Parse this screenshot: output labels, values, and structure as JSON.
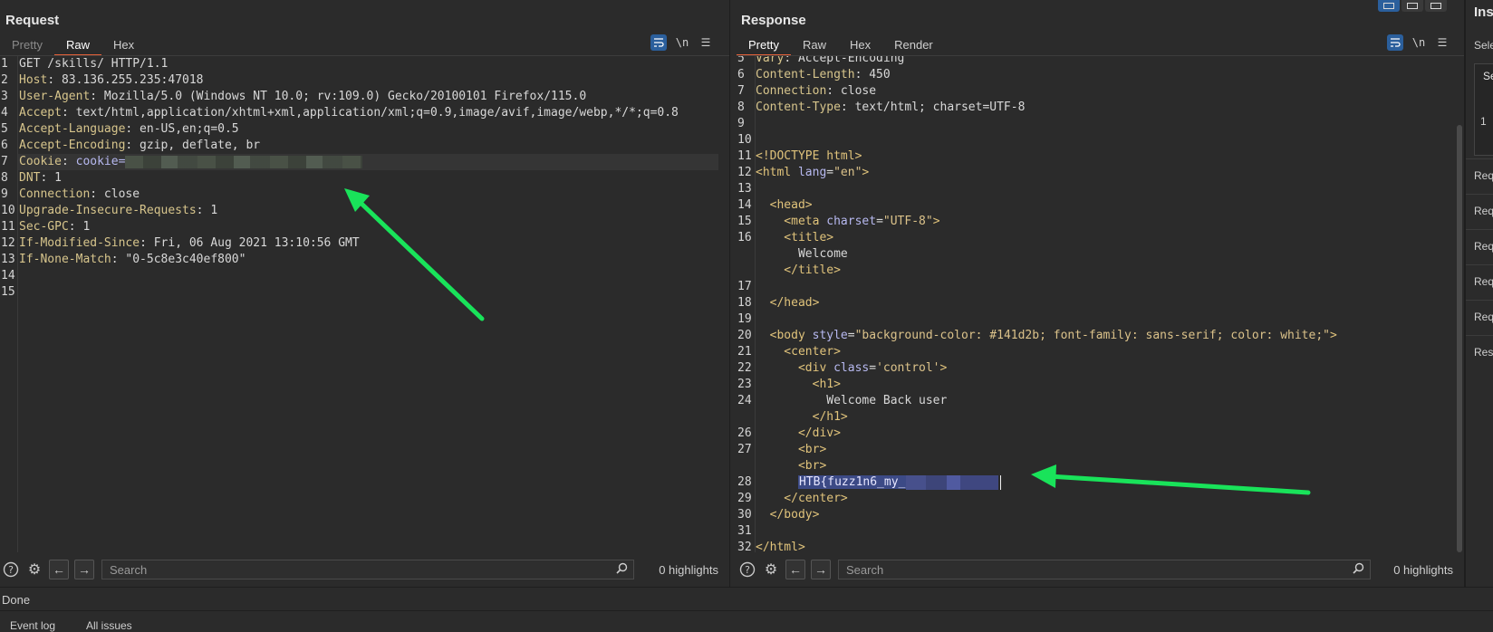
{
  "request": {
    "title": "Request",
    "tabs": [
      "Pretty",
      "Raw",
      "Hex"
    ],
    "active_tab": "Raw",
    "tools": {
      "wrap_icon": "wrap-icon",
      "newline_label": "\\n",
      "menu_icon": "menu-icon"
    },
    "lines": [
      {
        "n": "1",
        "parts": [
          {
            "t": "GET /skills/ HTTP/1.1",
            "c": "txt"
          }
        ]
      },
      {
        "n": "2",
        "parts": [
          {
            "t": "Host",
            "c": "hk"
          },
          {
            "t": ": 83.136.255.235:47018",
            "c": "txt"
          }
        ]
      },
      {
        "n": "3",
        "parts": [
          {
            "t": "User-Agent",
            "c": "hk"
          },
          {
            "t": ": Mozilla/5.0 (Windows NT 10.0; rv:109.0) Gecko/20100101 Firefox/115.0",
            "c": "txt"
          }
        ]
      },
      {
        "n": "4",
        "parts": [
          {
            "t": "Accept",
            "c": "hk"
          },
          {
            "t": ": text/html,application/xhtml+xml,application/xml;q=0.9,image/avif,image/webp,*/*;q=0.8",
            "c": "txt"
          }
        ]
      },
      {
        "n": "5",
        "parts": [
          {
            "t": "Accept-Language",
            "c": "hk"
          },
          {
            "t": ": en-US,en;q=0.5",
            "c": "txt"
          }
        ]
      },
      {
        "n": "6",
        "parts": [
          {
            "t": "Accept-Encoding",
            "c": "hk"
          },
          {
            "t": ": gzip, deflate, br",
            "c": "txt"
          }
        ]
      },
      {
        "n": "7",
        "parts": [
          {
            "t": "Cookie",
            "c": "hk"
          },
          {
            "t": ": ",
            "c": "txt"
          },
          {
            "t": "cookie=",
            "c": "attr"
          }
        ],
        "blur": "cookie"
      },
      {
        "n": "8",
        "parts": [
          {
            "t": "DNT",
            "c": "hk"
          },
          {
            "t": ": 1",
            "c": "txt"
          }
        ]
      },
      {
        "n": "9",
        "parts": [
          {
            "t": "Connection",
            "c": "hk"
          },
          {
            "t": ": close",
            "c": "txt"
          }
        ]
      },
      {
        "n": "10",
        "parts": [
          {
            "t": "Upgrade-Insecure-Requests",
            "c": "hk"
          },
          {
            "t": ": 1",
            "c": "txt"
          }
        ]
      },
      {
        "n": "11",
        "parts": [
          {
            "t": "Sec-GPC",
            "c": "hk"
          },
          {
            "t": ": 1",
            "c": "txt"
          }
        ]
      },
      {
        "n": "12",
        "parts": [
          {
            "t": "If-Modified-Since",
            "c": "hk"
          },
          {
            "t": ": Fri, 06 Aug 2021 13:10:56 GMT",
            "c": "txt"
          }
        ]
      },
      {
        "n": "13",
        "parts": [
          {
            "t": "If-None-Match",
            "c": "hk"
          },
          {
            "t": ": \"0-5c8e3c40ef800\"",
            "c": "txt"
          }
        ]
      },
      {
        "n": "14",
        "parts": []
      },
      {
        "n": "15",
        "parts": []
      }
    ],
    "search": {
      "placeholder": "Search",
      "highlights": "0 highlights"
    }
  },
  "response": {
    "title": "Response",
    "tabs": [
      "Pretty",
      "Raw",
      "Hex",
      "Render"
    ],
    "active_tab": "Pretty",
    "tools": {
      "wrap_icon": "wrap-icon",
      "newline_label": "\\n",
      "menu_icon": "menu-icon"
    },
    "lines": [
      {
        "n": "5",
        "parts": [
          {
            "t": "Vary",
            "c": "hk"
          },
          {
            "t": ": Accept-Encoding",
            "c": "txt"
          }
        ],
        "partial": true
      },
      {
        "n": "6",
        "parts": [
          {
            "t": "Content-Length",
            "c": "hk"
          },
          {
            "t": ": 450",
            "c": "txt"
          }
        ]
      },
      {
        "n": "7",
        "parts": [
          {
            "t": "Connection",
            "c": "hk"
          },
          {
            "t": ": close",
            "c": "txt"
          }
        ]
      },
      {
        "n": "8",
        "parts": [
          {
            "t": "Content-Type",
            "c": "hk"
          },
          {
            "t": ": text/html; charset=UTF-8",
            "c": "txt"
          }
        ]
      },
      {
        "n": "9",
        "parts": []
      },
      {
        "n": "10",
        "parts": []
      },
      {
        "n": "11",
        "parts": [
          {
            "t": "<!DOCTYPE html>",
            "c": "tag"
          }
        ]
      },
      {
        "n": "12",
        "parts": [
          {
            "t": "<html ",
            "c": "tag"
          },
          {
            "t": "lang",
            "c": "attr"
          },
          {
            "t": "=",
            "c": "txt"
          },
          {
            "t": "\"en\"",
            "c": "str"
          },
          {
            "t": ">",
            "c": "tag"
          }
        ]
      },
      {
        "n": "13",
        "parts": []
      },
      {
        "n": "14",
        "parts": [
          {
            "t": "  <head>",
            "c": "tag"
          }
        ]
      },
      {
        "n": "15",
        "parts": [
          {
            "t": "    <meta ",
            "c": "tag"
          },
          {
            "t": "charset",
            "c": "attr"
          },
          {
            "t": "=",
            "c": "txt"
          },
          {
            "t": "\"UTF-8\"",
            "c": "str"
          },
          {
            "t": ">",
            "c": "tag"
          }
        ]
      },
      {
        "n": "16",
        "parts": [
          {
            "t": "    <title>",
            "c": "tag"
          }
        ]
      },
      {
        "n": "",
        "parts": [
          {
            "t": "      Welcome",
            "c": "txt"
          }
        ]
      },
      {
        "n": "",
        "parts": [
          {
            "t": "    </title>",
            "c": "tag"
          }
        ]
      },
      {
        "n": "17",
        "parts": []
      },
      {
        "n": "18",
        "parts": [
          {
            "t": "  </head>",
            "c": "tag"
          }
        ]
      },
      {
        "n": "19",
        "parts": []
      },
      {
        "n": "20",
        "parts": [
          {
            "t": "  <body ",
            "c": "tag"
          },
          {
            "t": "style",
            "c": "attr"
          },
          {
            "t": "=",
            "c": "txt"
          },
          {
            "t": "\"background-color: #141d2b; font-family: sans-serif; color: white;\"",
            "c": "str"
          },
          {
            "t": ">",
            "c": "tag"
          }
        ]
      },
      {
        "n": "21",
        "parts": [
          {
            "t": "    <center>",
            "c": "tag"
          }
        ]
      },
      {
        "n": "22",
        "parts": [
          {
            "t": "      <div ",
            "c": "tag"
          },
          {
            "t": "class",
            "c": "attr"
          },
          {
            "t": "=",
            "c": "txt"
          },
          {
            "t": "'control'",
            "c": "str"
          },
          {
            "t": ">",
            "c": "tag"
          }
        ]
      },
      {
        "n": "23",
        "parts": [
          {
            "t": "        <h1>",
            "c": "tag"
          }
        ]
      },
      {
        "n": "24",
        "parts": [
          {
            "t": "          Welcome Back user",
            "c": "txt"
          }
        ]
      },
      {
        "n": "",
        "parts": [
          {
            "t": "        </h1>",
            "c": "tag"
          }
        ]
      },
      {
        "n": "26",
        "parts": [
          {
            "t": "      </div>",
            "c": "tag"
          }
        ]
      },
      {
        "n": "27",
        "parts": [
          {
            "t": "      <br>",
            "c": "tag"
          }
        ]
      },
      {
        "n": "",
        "parts": [
          {
            "t": "      <br>",
            "c": "tag"
          }
        ]
      },
      {
        "n": "28",
        "parts": [
          {
            "t": "      ",
            "c": "txt"
          },
          {
            "t": "HTB{fuzz1n6_my_",
            "c": "sel"
          }
        ],
        "blur": "flag"
      },
      {
        "n": "29",
        "parts": [
          {
            "t": "    </center>",
            "c": "tag"
          }
        ]
      },
      {
        "n": "30",
        "parts": [
          {
            "t": "  </body>",
            "c": "tag"
          }
        ]
      },
      {
        "n": "31",
        "parts": []
      },
      {
        "n": "32",
        "parts": [
          {
            "t": "</html>",
            "c": "tag"
          }
        ]
      }
    ],
    "search": {
      "placeholder": "Search",
      "highlights": "0 highlights"
    }
  },
  "inspector": {
    "title": "Inspector",
    "selection_label": "Selection",
    "box_header": "Se",
    "box_value": "1",
    "rows": [
      "Request attributes",
      "Request query parameters",
      "Request body parameters",
      "Request cookies",
      "Request headers",
      "Response headers"
    ]
  },
  "status": {
    "text": "Done"
  },
  "bottom_tabs": [
    "Event log",
    "All issues"
  ],
  "colors": {
    "accent": "#e8623a",
    "button_blue": "#2b5f9c",
    "arrow": "#19e35a"
  }
}
